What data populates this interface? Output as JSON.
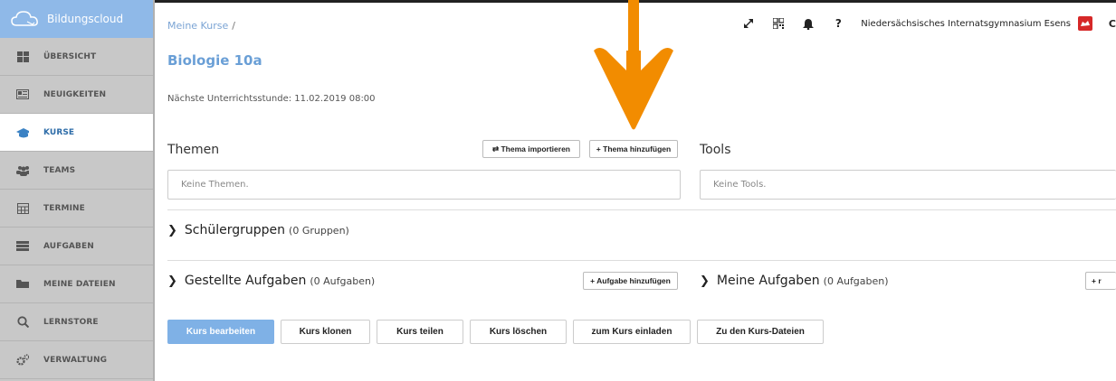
{
  "brand": {
    "name": "Bildungscloud"
  },
  "sidebar": {
    "items": [
      {
        "label": "ÜBERSICHT",
        "icon": "dashboard-icon"
      },
      {
        "label": "NEUIGKEITEN",
        "icon": "news-icon"
      },
      {
        "label": "KURSE",
        "icon": "graduation-cap-icon",
        "active": true
      },
      {
        "label": "TEAMS",
        "icon": "users-icon"
      },
      {
        "label": "TERMINE",
        "icon": "calendar-icon"
      },
      {
        "label": "AUFGABEN",
        "icon": "tasks-icon"
      },
      {
        "label": "MEINE DATEIEN",
        "icon": "folder-icon"
      },
      {
        "label": "LERNSTORE",
        "icon": "search-icon"
      },
      {
        "label": "VERWALTUNG",
        "icon": "gears-icon"
      }
    ]
  },
  "header": {
    "breadcrumb": "Meine Kurse",
    "breadcrumb_sep": "/",
    "title": "Biologie 10a",
    "next_lesson": "Nächste Unterrichtsstunde: 11.02.2019 08:00",
    "school": "Niedersächsisches Internatsgymnasium Esens",
    "help": "?",
    "cut_letter": "C"
  },
  "themen": {
    "title": "Themen",
    "import_label": "⇄ Thema importieren",
    "add_label": "+ Thema hinzufügen",
    "empty": "Keine Themen."
  },
  "tools": {
    "title": "Tools",
    "empty": "Keine Tools."
  },
  "groups": {
    "title": "Schülergruppen",
    "count": "(0 Gruppen)"
  },
  "assigned": {
    "title": "Gestellte Aufgaben",
    "count": "(0 Aufgaben)",
    "add_label": "+ Aufgabe hinzufügen"
  },
  "my_tasks": {
    "title": "Meine Aufgaben",
    "count": "(0 Aufgaben)",
    "add_label_cut": "+ r"
  },
  "actions": {
    "edit": "Kurs bearbeiten",
    "clone": "Kurs klonen",
    "share": "Kurs teilen",
    "delete": "Kurs löschen",
    "invite": "zum Kurs einladen",
    "files": "Zu den Kurs-Dateien"
  },
  "colors": {
    "accent": "#7fb1e6",
    "arrow": "#f28c00",
    "sidebar_bg": "#c8c8c8"
  }
}
